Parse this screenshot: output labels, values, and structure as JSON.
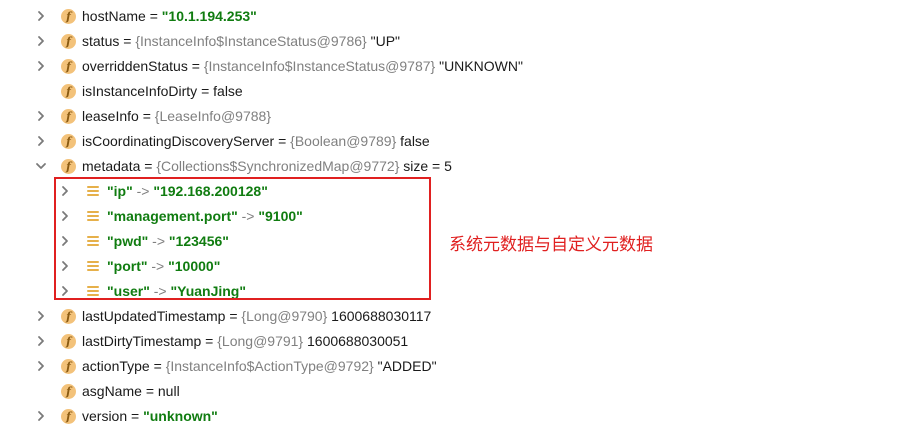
{
  "rows": [
    {
      "name": "hostName",
      "ref": "",
      "value": "\"10.1.194.253\"",
      "value_style": "str",
      "expand": "collapsed"
    },
    {
      "name": "status",
      "ref": "{InstanceInfo$InstanceStatus@9786}",
      "value": "\"UP\"",
      "value_style": "val",
      "expand": "collapsed"
    },
    {
      "name": "overriddenStatus",
      "ref": "{InstanceInfo$InstanceStatus@9787}",
      "value": "\"UNKNOWN\"",
      "value_style": "val",
      "expand": "collapsed"
    },
    {
      "name": "isInstanceInfoDirty",
      "ref": "",
      "value": "false",
      "value_style": "val",
      "expand": "none"
    },
    {
      "name": "leaseInfo",
      "ref": "{LeaseInfo@9788}",
      "value": "",
      "value_style": "val",
      "expand": "collapsed"
    },
    {
      "name": "isCoordinatingDiscoveryServer",
      "ref": "{Boolean@9789}",
      "value": "false",
      "value_style": "val",
      "expand": "collapsed"
    },
    {
      "name": "metadata",
      "ref": "{Collections$SynchronizedMap@9772}",
      "value": " size = 5",
      "value_style": "val",
      "expand": "expanded"
    }
  ],
  "metadata_entries": [
    {
      "key": "\"ip\"",
      "value": "\"192.168.200128\""
    },
    {
      "key": "\"management.port\"",
      "value": "\"9100\""
    },
    {
      "key": "\"pwd\"",
      "value": "\"123456\""
    },
    {
      "key": "\"port\"",
      "value": "\"10000\""
    },
    {
      "key": "\"user\"",
      "value": "\"YuanJing\""
    }
  ],
  "rows_after": [
    {
      "name": "lastUpdatedTimestamp",
      "ref": "{Long@9790}",
      "value": "1600688030117",
      "value_style": "val",
      "expand": "collapsed"
    },
    {
      "name": "lastDirtyTimestamp",
      "ref": "{Long@9791}",
      "value": "1600688030051",
      "value_style": "val",
      "expand": "collapsed"
    },
    {
      "name": "actionType",
      "ref": "{InstanceInfo$ActionType@9792}",
      "value": "\"ADDED\"",
      "value_style": "val",
      "expand": "collapsed"
    },
    {
      "name": "asgName",
      "ref": "",
      "value": "null",
      "value_style": "val",
      "expand": "none"
    },
    {
      "name": "version",
      "ref": "",
      "value": "\"unknown\"",
      "value_style": "str",
      "expand": "collapsed"
    }
  ],
  "arrow_text": "->",
  "equals_text": "=",
  "field_icon_letter": "f",
  "annotation": "系统元数据与自定义元数据",
  "colors": {
    "string_value": "#107c10",
    "reference": "#808080",
    "highlight": "#e02020",
    "field_icon": "#f3c27a"
  }
}
